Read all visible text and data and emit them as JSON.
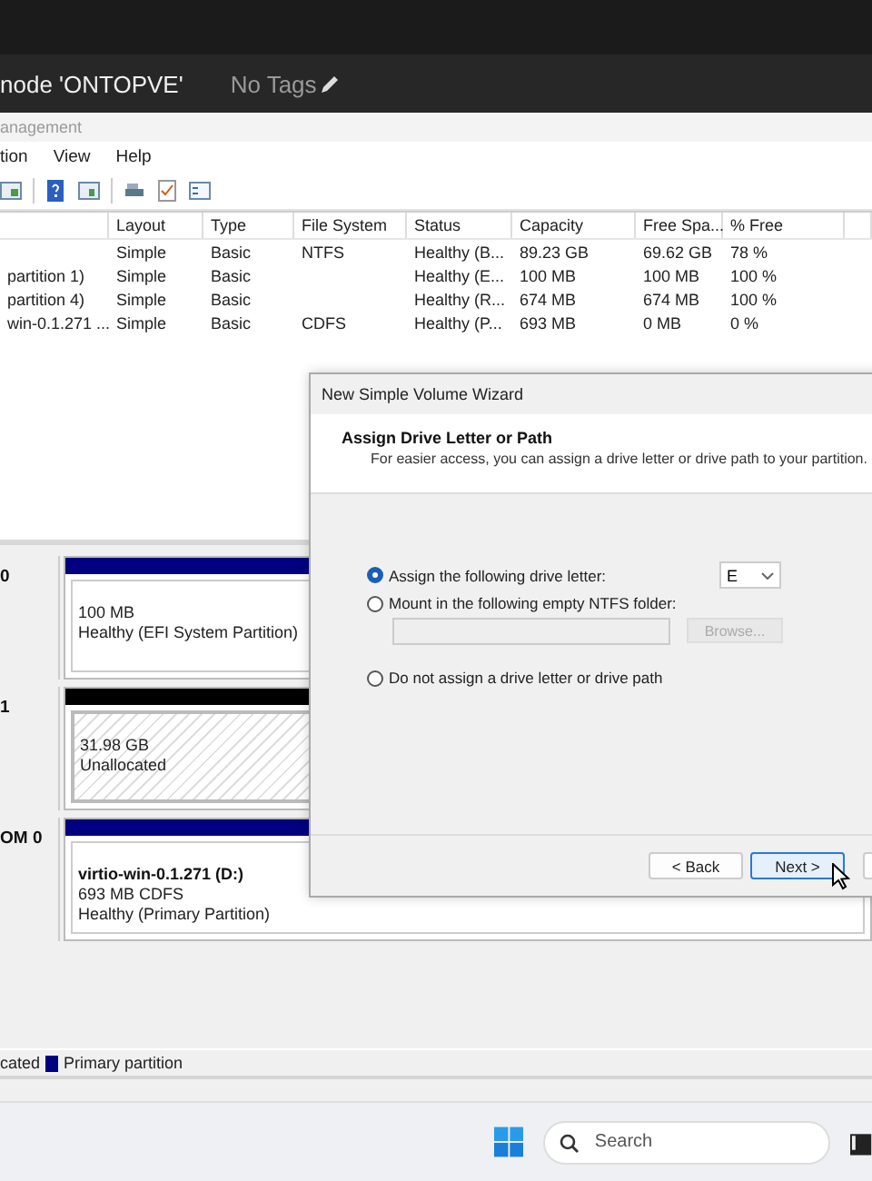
{
  "console": {
    "node_label": "node 'ONTOPVE'",
    "tags": "No Tags"
  },
  "window": {
    "title": "anagement"
  },
  "menu": [
    "tion",
    "View",
    "Help"
  ],
  "table": {
    "columns": [
      "",
      "Layout",
      "Type",
      "File System",
      "Status",
      "Capacity",
      "Free Spa...",
      "% Free"
    ],
    "rows": [
      [
        "",
        "Simple",
        "Basic",
        "NTFS",
        "Healthy (B...",
        "89.23 GB",
        "69.62 GB",
        "78 %"
      ],
      [
        "partition 1)",
        "Simple",
        "Basic",
        "",
        "Healthy (E...",
        "100 MB",
        "100 MB",
        "100 %"
      ],
      [
        "partition 4)",
        "Simple",
        "Basic",
        "",
        "Healthy (R...",
        "674 MB",
        "674 MB",
        "100 %"
      ],
      [
        "win-0.1.271 ...",
        "Simple",
        "Basic",
        "CDFS",
        "Healthy (P...",
        "693 MB",
        "0 MB",
        "0 %"
      ]
    ]
  },
  "disks": [
    {
      "label": "0",
      "partition": {
        "kind": "primary",
        "lines": [
          "100 MB",
          "Healthy (EFI System Partition)"
        ]
      }
    },
    {
      "label": "1",
      "partition": {
        "kind": "unallocated",
        "lines": [
          "31.98 GB",
          "Unallocated"
        ]
      }
    },
    {
      "label": "OM 0",
      "partition": {
        "kind": "primary",
        "name": "virtio-win-0.1.271  (D:)",
        "lines": [
          "693 MB CDFS",
          "Healthy (Primary Partition)"
        ]
      }
    }
  ],
  "legend": [
    {
      "label": "cated"
    },
    {
      "label": "Primary partition",
      "color": "#000080"
    }
  ],
  "dialog": {
    "title": "New Simple Volume Wizard",
    "heading": "Assign Drive Letter or Path",
    "subtitle": "For easier access, you can assign a drive letter or drive path to your partition.",
    "options": [
      {
        "kind": "letter",
        "label": "Assign the following drive letter:",
        "selected": true,
        "value": "E"
      },
      {
        "kind": "folder",
        "label": "Mount in the following empty NTFS folder:",
        "selected": false,
        "button": "Browse..."
      },
      {
        "kind": "none",
        "label": "Do not assign a drive letter or drive path",
        "selected": false
      }
    ],
    "buttons": [
      {
        "label": "< Back",
        "focused": false
      },
      {
        "label": "Next >",
        "focused": true
      }
    ]
  },
  "taskbar": {
    "search_placeholder": "Search"
  }
}
